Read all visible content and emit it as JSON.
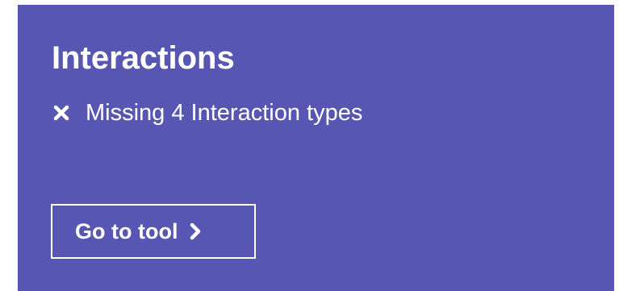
{
  "card": {
    "title": "Interactions",
    "background_color": "#5856b3",
    "text_color": "#ffffff",
    "status": {
      "icon": "close-icon",
      "text": "Missing 4 Interaction types"
    },
    "button": {
      "label": "Go to tool",
      "icon": "chevron-right-icon"
    }
  }
}
